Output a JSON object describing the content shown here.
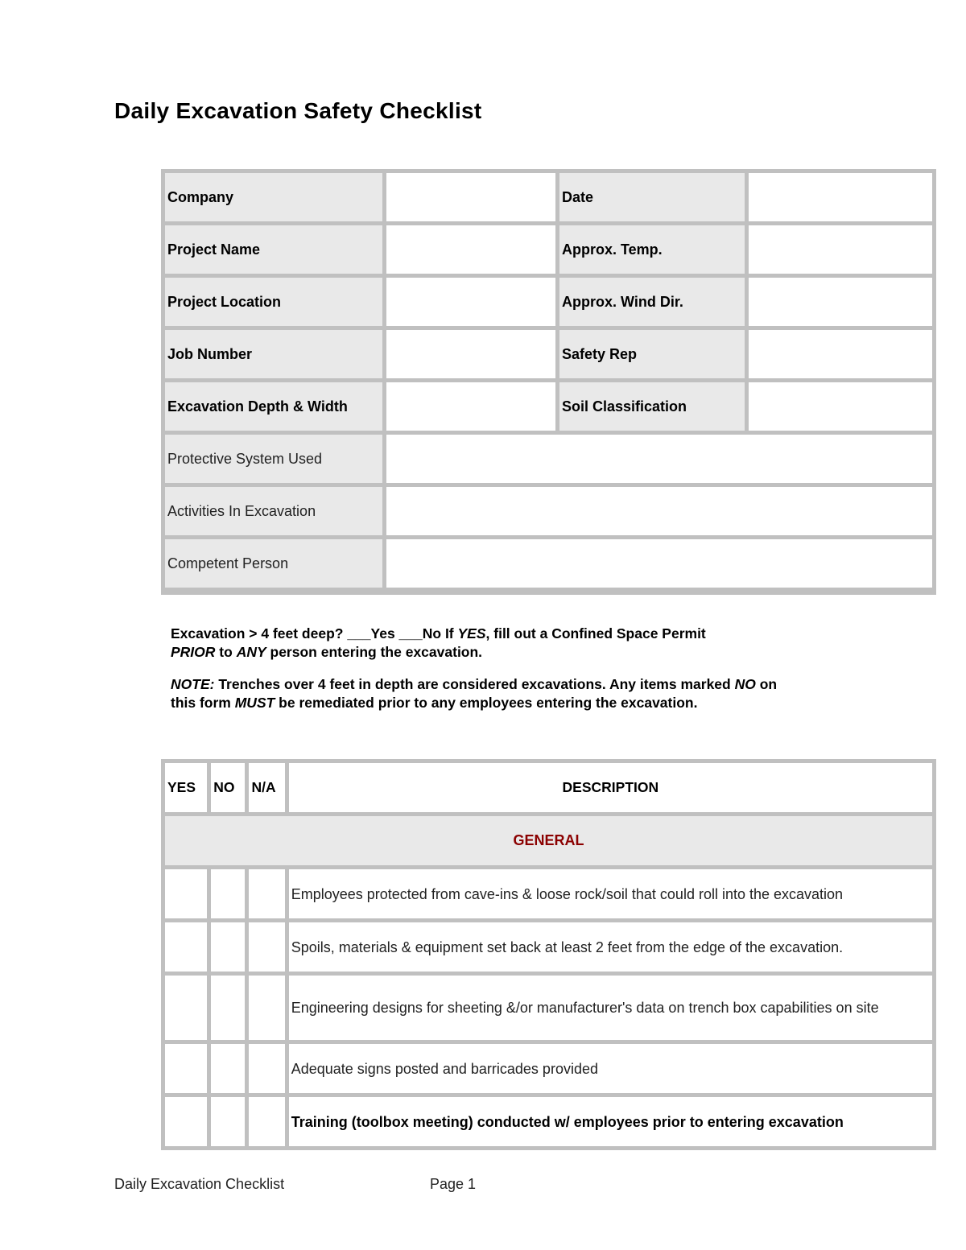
{
  "document": {
    "title": "Daily Excavation Safety Checklist"
  },
  "info_table": {
    "rows": [
      {
        "left_label": "Company",
        "right_label": "Date"
      },
      {
        "left_label": "Project Name",
        "right_label": "Approx. Temp."
      },
      {
        "left_label": "Project Location",
        "right_label": "Approx. Wind Dir."
      },
      {
        "left_label": "Job Number",
        "right_label": "Safety Rep"
      },
      {
        "left_label": "Excavation Depth & Width",
        "right_label": "Soil Classification"
      }
    ],
    "wide_rows": [
      {
        "label": "Protective System Used"
      },
      {
        "label": "Activities In Excavation"
      },
      {
        "label": "Competent Person"
      }
    ]
  },
  "notes": {
    "depth_question_a": "Excavation > 4 feet deep? ___Yes ___No If ",
    "depth_question_yes": "YES",
    "depth_question_b": ", fill out a Confined Space Permit ",
    "depth_question_prior": "PRIOR",
    "depth_question_c": " to ",
    "depth_question_any": "ANY",
    "depth_question_d": " person entering the excavation.",
    "note_label": "NOTE:",
    "note_a": " Trenches over 4 feet in depth are considered excavations. Any items marked ",
    "note_no": "NO",
    "note_b": " on this form ",
    "note_must": "MUST",
    "note_c": " be remediated prior to any employees entering the excavation."
  },
  "checklist": {
    "headers": {
      "yes": "YES",
      "no": "NO",
      "na": "N/A",
      "description": "DESCRIPTION"
    },
    "section_color": "#8b0000",
    "sections": [
      {
        "title": "GENERAL",
        "items": [
          {
            "text": "Employees protected from cave-ins & loose rock/soil that could roll into the excavation",
            "bold": false
          },
          {
            "text": "Spoils, materials & equipment set back at least 2 feet from the edge of the excavation.",
            "bold": false
          },
          {
            "text": "Engineering designs for sheeting &/or manufacturer's data on trench box capabilities on site",
            "bold": false
          },
          {
            "text": "Adequate signs posted and barricades provided",
            "bold": false
          },
          {
            "text": "Training (toolbox meeting) conducted w/ employees prior to entering excavation",
            "bold": true
          }
        ]
      }
    ]
  },
  "footer": {
    "left": "Daily Excavation Checklist",
    "page": "Page 1"
  }
}
